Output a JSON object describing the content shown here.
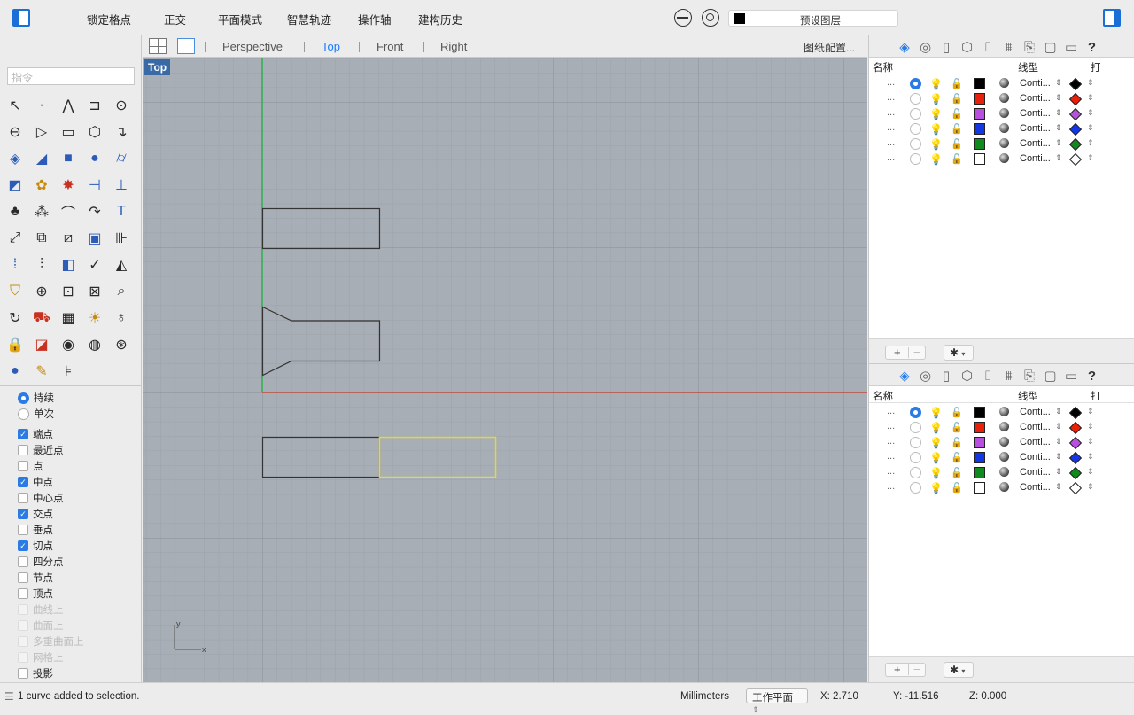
{
  "toolbar": {
    "modes": [
      "锁定格点",
      "正交",
      "平面模式",
      "智慧轨迹",
      "操作轴",
      "建构历史"
    ],
    "layer_current": "预设图层",
    "icons": [
      "left-panel-icon",
      "osnap-icon",
      "record-history-icon",
      "right-panel-icon"
    ]
  },
  "command": {
    "placeholder": "指令"
  },
  "viewport_tabs": {
    "tabs": [
      "Perspective",
      "Top",
      "Front",
      "Right"
    ],
    "active": "Top",
    "layout_button": "图纸配置..."
  },
  "viewport": {
    "label": "Top",
    "axis_x": "x",
    "axis_y": "y"
  },
  "osnap": {
    "modes": [
      {
        "label": "持续",
        "checked": true
      },
      {
        "label": "单次",
        "checked": false
      }
    ],
    "items": [
      {
        "label": "端点",
        "checked": true,
        "enabled": true
      },
      {
        "label": "最近点",
        "checked": false,
        "enabled": true
      },
      {
        "label": "点",
        "checked": false,
        "enabled": true
      },
      {
        "label": "中点",
        "checked": true,
        "enabled": true
      },
      {
        "label": "中心点",
        "checked": false,
        "enabled": true
      },
      {
        "label": "交点",
        "checked": true,
        "enabled": true
      },
      {
        "label": "垂点",
        "checked": false,
        "enabled": true
      },
      {
        "label": "切点",
        "checked": true,
        "enabled": true
      },
      {
        "label": "四分点",
        "checked": false,
        "enabled": true
      },
      {
        "label": "节点",
        "checked": false,
        "enabled": true
      },
      {
        "label": "顶点",
        "checked": false,
        "enabled": true
      },
      {
        "label": "曲线上",
        "checked": false,
        "enabled": false
      },
      {
        "label": "曲面上",
        "checked": false,
        "enabled": false
      },
      {
        "label": "多重曲面上",
        "checked": false,
        "enabled": false
      },
      {
        "label": "网格上",
        "checked": false,
        "enabled": false
      },
      {
        "label": "投影",
        "checked": false,
        "enabled": true
      }
    ]
  },
  "layers_panel": {
    "headers": {
      "name": "名称",
      "linetype": "线型",
      "print": "打"
    },
    "rows": [
      {
        "name": "...",
        "current": true,
        "color": "#000000",
        "linetype": "Conti...",
        "print_color": "#000000"
      },
      {
        "name": "...",
        "current": false,
        "color": "#e8200c",
        "linetype": "Conti...",
        "print_color": "#e8200c"
      },
      {
        "name": "...",
        "current": false,
        "color": "#b84fe0",
        "linetype": "Conti...",
        "print_color": "#b84fe0"
      },
      {
        "name": "...",
        "current": false,
        "color": "#1437e6",
        "linetype": "Conti...",
        "print_color": "#1437e6"
      },
      {
        "name": "...",
        "current": false,
        "color": "#0f8a1c",
        "linetype": "Conti...",
        "print_color": "#0f8a1c"
      },
      {
        "name": "...",
        "current": false,
        "color": "#ffffff",
        "linetype": "Conti...",
        "print_color": "#ffffff"
      }
    ],
    "footer": {
      "add": "+",
      "remove": "−",
      "gear": "✱"
    }
  },
  "status_bar": {
    "message": "1 curve added to selection.",
    "units": "Millimeters",
    "cplane": "工作平面",
    "x": "X: 2.710",
    "y": "Y: -11.516",
    "z": "Z: 0.000"
  }
}
